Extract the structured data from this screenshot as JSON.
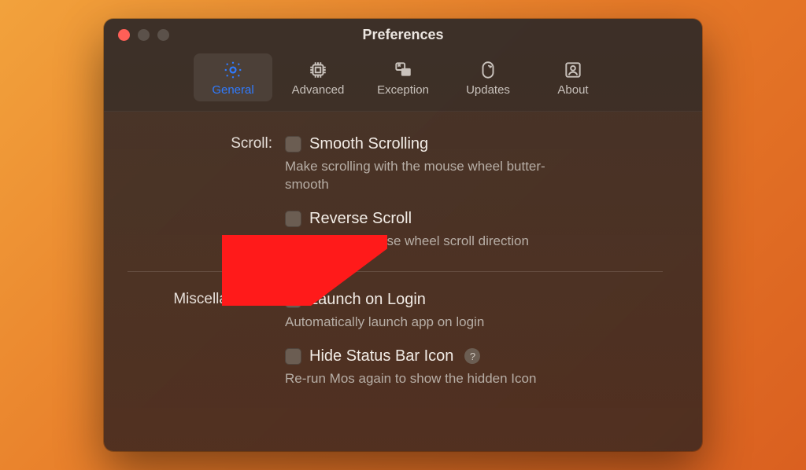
{
  "window": {
    "title": "Preferences"
  },
  "tabs": {
    "general": {
      "label": "General"
    },
    "advanced": {
      "label": "Advanced"
    },
    "exception": {
      "label": "Exception"
    },
    "updates": {
      "label": "Updates"
    },
    "about": {
      "label": "About"
    }
  },
  "sections": {
    "scroll": {
      "label": "Scroll:",
      "smooth": {
        "title": "Smooth Scrolling",
        "desc": "Make scrolling with the mouse wheel butter-smooth"
      },
      "reverse": {
        "title": "Reverse Scroll",
        "desc": "Reverse the mouse wheel scroll direction"
      }
    },
    "misc": {
      "label": "Miscellaneous:",
      "launch": {
        "title": "Launch on Login",
        "desc": "Automatically launch app on login"
      },
      "hide": {
        "title": "Hide Status Bar Icon",
        "desc": "Re-run Mos again to show the hidden Icon"
      }
    }
  },
  "help": {
    "glyph": "?"
  }
}
